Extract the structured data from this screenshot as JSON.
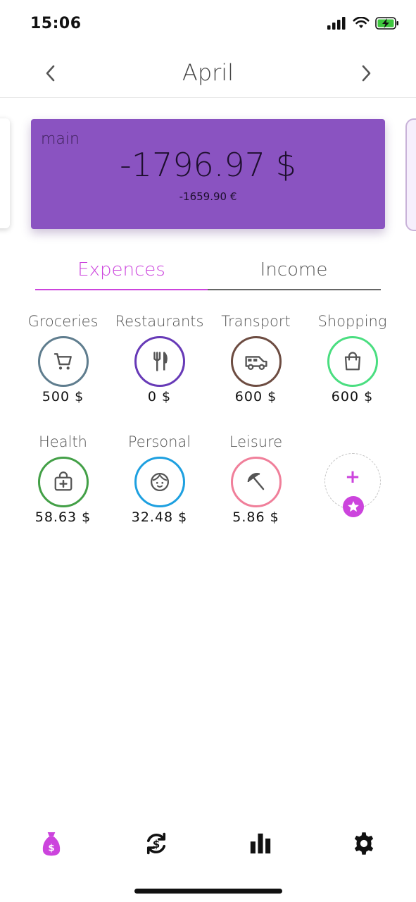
{
  "status_bar": {
    "time": "15:06"
  },
  "header": {
    "month": "April"
  },
  "account": {
    "name": "main",
    "balance": "-1796.97 $",
    "balance_converted": "-1659.90 €",
    "card_color": "#8a53c1"
  },
  "tabs": [
    {
      "label": "Expences",
      "active": true
    },
    {
      "label": "Income",
      "active": false
    }
  ],
  "accent_color": "#cc44dd",
  "categories": [
    {
      "name": "Groceries",
      "amount": "500 $",
      "icon": "cart-icon",
      "color": "#5f7d8e"
    },
    {
      "name": "Restaurants",
      "amount": "0 $",
      "icon": "fork-knife-icon",
      "color": "#673ab7"
    },
    {
      "name": "Transport",
      "amount": "600 $",
      "icon": "van-icon",
      "color": "#6d4c41"
    },
    {
      "name": "Shopping",
      "amount": "600 $",
      "icon": "shopping-bag-icon",
      "color": "#4ade80"
    },
    {
      "name": "Health",
      "amount": "58.63 $",
      "icon": "medical-kit-icon",
      "color": "#43a047"
    },
    {
      "name": "Personal",
      "amount": "32.48 $",
      "icon": "face-icon",
      "color": "#1ea0e0"
    },
    {
      "name": "Leisure",
      "amount": "5.86 $",
      "icon": "beach-umbrella-icon",
      "color": "#f07f9a"
    }
  ],
  "add_category": {
    "label": "+",
    "icon": "star-icon"
  },
  "bottom_nav": [
    {
      "icon": "money-bag-icon",
      "active": true
    },
    {
      "icon": "exchange-icon",
      "active": false
    },
    {
      "icon": "bar-chart-icon",
      "active": false
    },
    {
      "icon": "gear-icon",
      "active": false
    }
  ]
}
